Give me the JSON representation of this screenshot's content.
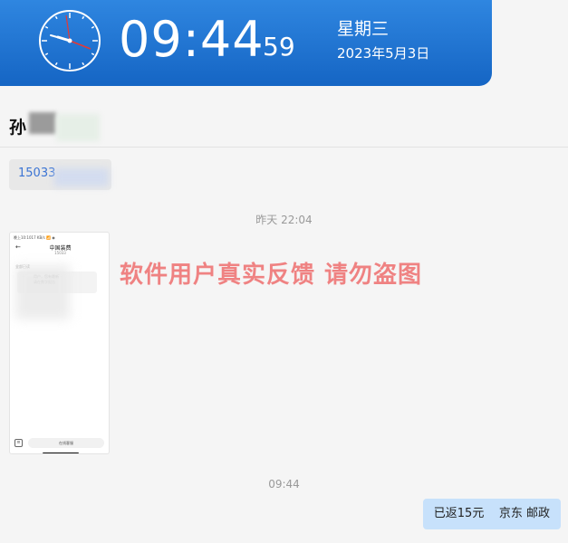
{
  "clock": {
    "time": "09:44",
    "seconds": "59",
    "weekday": "星期三",
    "date": "2023年5月3日"
  },
  "header": {
    "contact_name": "孙"
  },
  "messages": {
    "phone": "15033",
    "timestamp_yesterday": "昨天 22:04",
    "screenshot": {
      "status_bar": "晚上10:1017 KB/s 📶 ◉",
      "title": "中国装费",
      "subtitle": "15033",
      "label": "全部已读",
      "message_text": "用户，您有最新\n请在数字报告",
      "input_placeholder": "在线客服"
    },
    "watermark": "软件用户真实反馈  请勿盗图",
    "timestamp_today": "09:44",
    "outgoing": "已返15元    京东 邮政"
  },
  "colors": {
    "banner": "#1e73d2",
    "outgoing_bubble": "#c7e1fb",
    "watermark": "#ee6f6f"
  }
}
